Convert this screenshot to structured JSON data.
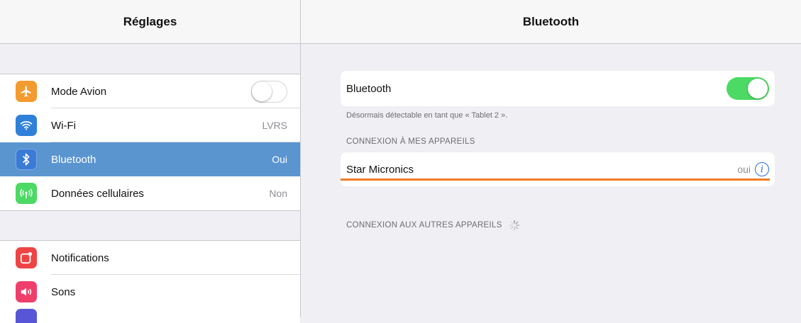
{
  "colors": {
    "selected_row": "#5a95d0",
    "toggle_on": "#4cd964",
    "info_blue": "#1e6fd9",
    "highlight_underline": "#f07b27",
    "icon_airplane": "#f39b2f",
    "icon_wifi": "#2f80d8",
    "icon_bluetooth": "#3a7bd5",
    "icon_cellular": "#4cd964",
    "icon_notifications": "#ef4444",
    "icon_sounds": "#ef3e6a"
  },
  "sidebar": {
    "title": "Réglages",
    "items": [
      {
        "label": "Mode Avion",
        "value": "",
        "icon": "airplane-icon",
        "control": "toggle-off"
      },
      {
        "label": "Wi-Fi",
        "value": "LVRS",
        "icon": "wifi-icon"
      },
      {
        "label": "Bluetooth",
        "value": "Oui",
        "icon": "bluetooth-icon",
        "selected": true
      },
      {
        "label": "Données cellulaires",
        "value": "Non",
        "icon": "cellular-icon"
      },
      {
        "label": "Notifications",
        "value": "",
        "icon": "notifications-icon"
      },
      {
        "label": "Sons",
        "value": "",
        "icon": "sounds-icon"
      }
    ]
  },
  "detail": {
    "title": "Bluetooth",
    "bluetooth_label": "Bluetooth",
    "bluetooth_on": true,
    "discoverable_text": "Désormais détectable en tant que « Tablet 2 ».",
    "my_devices_header": "CONNEXION À MES APPAREILS",
    "device_name": "Star Micronics",
    "device_status": "oui",
    "other_devices_header": "CONNEXION AUX AUTRES APPAREILS"
  }
}
